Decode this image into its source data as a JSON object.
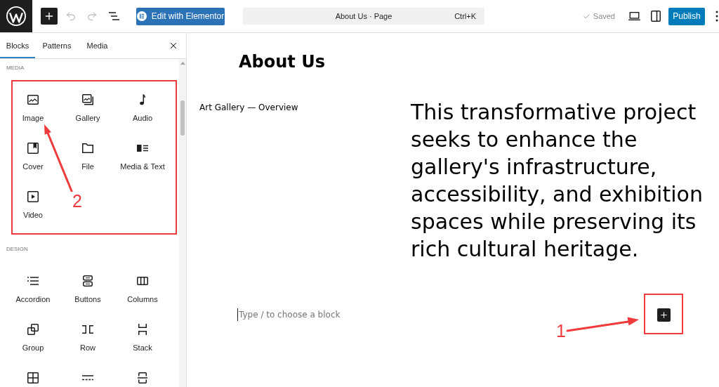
{
  "toolbar": {
    "undo": {
      "disabled": true
    },
    "redo": {
      "disabled": true
    },
    "elementor_button": "Edit with Elementor",
    "command_bar": {
      "title": "About Us · Page",
      "shortcut": "Ctrl+K"
    },
    "save_status": "Saved",
    "publish_button": "Publish"
  },
  "inserter": {
    "tabs": [
      {
        "label": "Blocks",
        "selected": true
      },
      {
        "label": "Patterns",
        "selected": false
      },
      {
        "label": "Media",
        "selected": false
      }
    ],
    "categories": [
      {
        "heading": "MEDIA",
        "items": [
          {
            "label": "Image"
          },
          {
            "label": "Gallery"
          },
          {
            "label": "Audio"
          },
          {
            "label": "Cover"
          },
          {
            "label": "File"
          },
          {
            "label": "Media & Text"
          },
          {
            "label": "Video"
          }
        ]
      },
      {
        "heading": "DESIGN",
        "items": [
          {
            "label": "Accordion"
          },
          {
            "label": "Buttons"
          },
          {
            "label": "Columns"
          },
          {
            "label": "Group"
          },
          {
            "label": "Row"
          },
          {
            "label": "Stack"
          }
        ]
      }
    ]
  },
  "canvas": {
    "title": "About Us",
    "paragraph": "Art Gallery — Overview",
    "text": "This transformative project seeks to enhance the gallery's infrastructure, accessibility, and exhibition spaces while preserving its rich cultural heritage.",
    "block_input": {
      "placeholder": "Type / to choose a block"
    }
  },
  "annotations": [
    {
      "label": "1"
    },
    {
      "label": "2"
    }
  ]
}
